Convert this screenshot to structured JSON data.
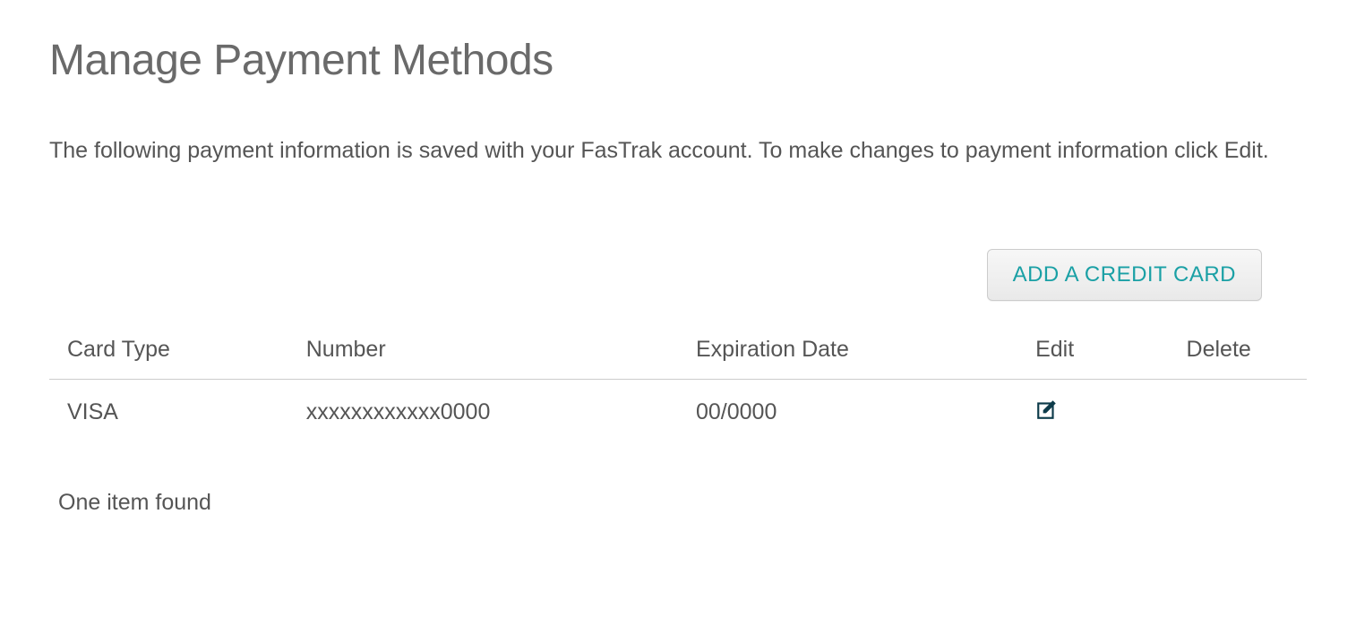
{
  "page": {
    "title": "Manage Payment Methods",
    "description": "The following payment information is saved with your FasTrak account. To make changes to payment information click Edit."
  },
  "actions": {
    "add_card_label": "ADD A CREDIT CARD"
  },
  "table": {
    "headers": {
      "card_type": "Card Type",
      "number": "Number",
      "expiration": "Expiration Date",
      "edit": "Edit",
      "delete": "Delete"
    },
    "rows": [
      {
        "card_type": "VISA",
        "number": "xxxxxxxxxxxx0000",
        "expiration": "00/0000"
      }
    ]
  },
  "footer": {
    "result_count": "One item found"
  }
}
